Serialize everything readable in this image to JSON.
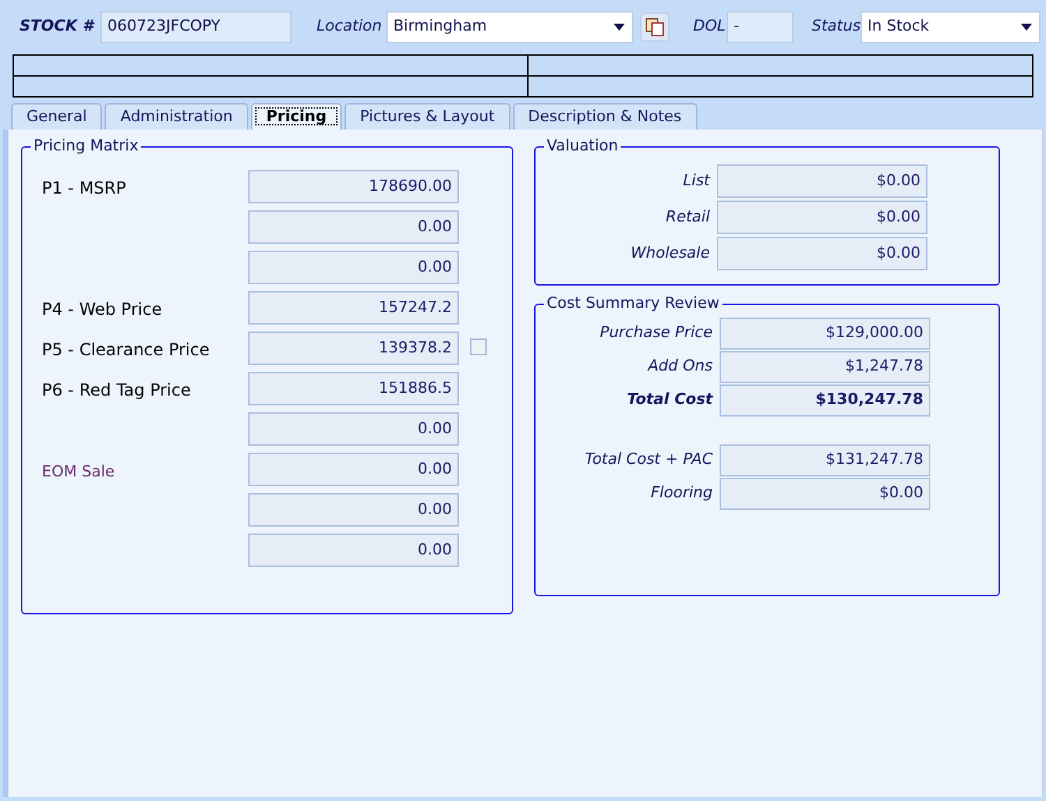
{
  "header": {
    "stock_label": "STOCK #",
    "stock_value": "060723JFCOPY",
    "location_label": "Location",
    "location_value": "Birmingham",
    "dol_label": "DOL",
    "dol_value": "-",
    "status_label": "Status",
    "status_value": "In Stock"
  },
  "tabs": [
    {
      "label": "General",
      "selected": false
    },
    {
      "label": "Administration",
      "selected": false
    },
    {
      "label": "Pricing",
      "selected": true
    },
    {
      "label": "Pictures & Layout",
      "selected": false
    },
    {
      "label": "Description & Notes",
      "selected": false
    }
  ],
  "pricing_matrix": {
    "title": "Pricing Matrix",
    "rows": [
      {
        "kind": "price",
        "label": "P1 - MSRP",
        "value": "178690.00"
      },
      {
        "kind": "blank",
        "value": "0.00"
      },
      {
        "kind": "blank",
        "value": "0.00"
      },
      {
        "kind": "price",
        "label": "P4 - Web Price",
        "value": "157247.2"
      },
      {
        "kind": "price",
        "label": "P5 - Clearance Price",
        "value": "139378.2",
        "checkbox": {
          "checked": false
        }
      },
      {
        "kind": "price",
        "label": "P6 - Red Tag Price",
        "value": "151886.5"
      },
      {
        "kind": "blank",
        "value": "0.00"
      },
      {
        "kind": "note",
        "label": "EOM Sale",
        "value": "0.00"
      },
      {
        "kind": "blank",
        "value": "0.00"
      },
      {
        "kind": "blank",
        "value": "0.00"
      }
    ]
  },
  "valuation": {
    "title": "Valuation",
    "rows": [
      {
        "label": "List",
        "value": "$0.00"
      },
      {
        "label": "Retail",
        "value": "$0.00"
      },
      {
        "label": "Wholesale",
        "value": "$0.00"
      }
    ]
  },
  "cost_summary": {
    "title": "Cost Summary Review",
    "rows": [
      {
        "kind": "normal",
        "label": "Purchase Price",
        "value": "$129,000.00"
      },
      {
        "kind": "normal",
        "label": "Add Ons",
        "value": "$1,247.78"
      },
      {
        "kind": "total",
        "label": "Total Cost",
        "value": "$130,247.78"
      },
      {
        "kind": "spaced",
        "label": "Total Cost + PAC",
        "value": "$131,247.78"
      },
      {
        "kind": "normal",
        "label": "Flooring",
        "value": "$0.00"
      }
    ]
  }
}
